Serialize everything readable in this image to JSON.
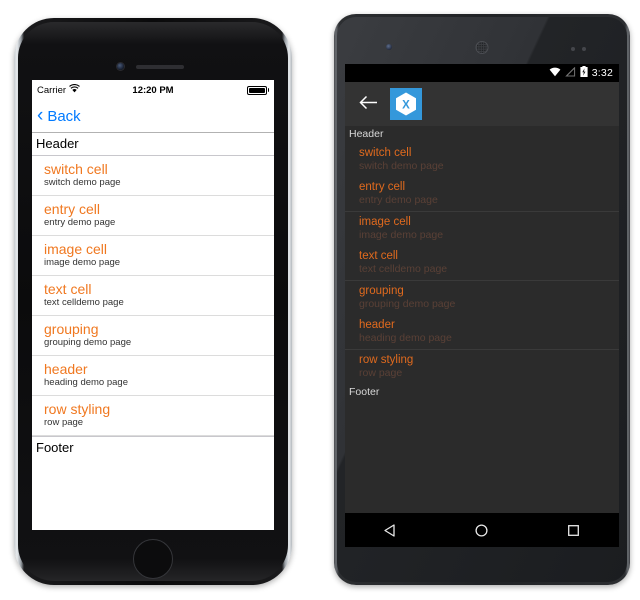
{
  "ios": {
    "status_bar": {
      "carrier": "Carrier",
      "wifi_icon": "wifi-icon",
      "time": "12:20 PM",
      "battery_icon": "battery-full-icon"
    },
    "nav_bar": {
      "back_chevron_icon": "chevron-left-icon",
      "back_label": "Back",
      "accent_color": "#007aff"
    },
    "list": {
      "header_label": "Header",
      "footer_label": "Footer",
      "title_color": "#f07820",
      "detail_color": "#333333",
      "items": [
        {
          "title": "switch cell",
          "detail": "switch demo page"
        },
        {
          "title": "entry cell",
          "detail": "entry demo page"
        },
        {
          "title": "image cell",
          "detail": "image demo page"
        },
        {
          "title": "text cell",
          "detail": "text celldemo page"
        },
        {
          "title": "grouping",
          "detail": "grouping demo page"
        },
        {
          "title": "header",
          "detail": "heading demo page"
        },
        {
          "title": "row styling",
          "detail": "row page"
        }
      ]
    },
    "hardware": {
      "camera_icon": "front-camera-icon",
      "speaker_icon": "earpiece-speaker-icon",
      "home_button_icon": "home-button-icon"
    }
  },
  "android": {
    "status_bar": {
      "wifi_icon": "wifi-icon",
      "signal_icon": "cell-signal-off-icon",
      "battery_icon": "battery-charging-icon",
      "time": "3:32"
    },
    "action_bar": {
      "back_arrow_icon": "arrow-left-icon",
      "app_logo_icon": "xamarin-logo-icon",
      "logo_bg_color": "#3498db"
    },
    "list": {
      "header_label": "Header",
      "footer_label": "Footer",
      "title_color": "#e06a1e",
      "detail_color": "#5a4036",
      "items": [
        {
          "title": "switch cell",
          "detail": "switch demo page"
        },
        {
          "title": "entry cell",
          "detail": "entry demo page"
        },
        {
          "title": "image cell",
          "detail": "image demo page"
        },
        {
          "title": "text cell",
          "detail": "text celldemo page"
        },
        {
          "title": "grouping",
          "detail": "grouping demo page"
        },
        {
          "title": "header",
          "detail": "heading demo page"
        },
        {
          "title": "row styling",
          "detail": "row page"
        }
      ]
    },
    "nav_bar": {
      "back_icon": "nav-back-triangle-icon",
      "home_icon": "nav-home-circle-icon",
      "recents_icon": "nav-recents-square-icon"
    },
    "hardware": {
      "camera_icon": "front-camera-icon",
      "speaker_icon": "earpiece-speaker-icon",
      "sensor_icon": "proximity-sensor-icon"
    }
  }
}
